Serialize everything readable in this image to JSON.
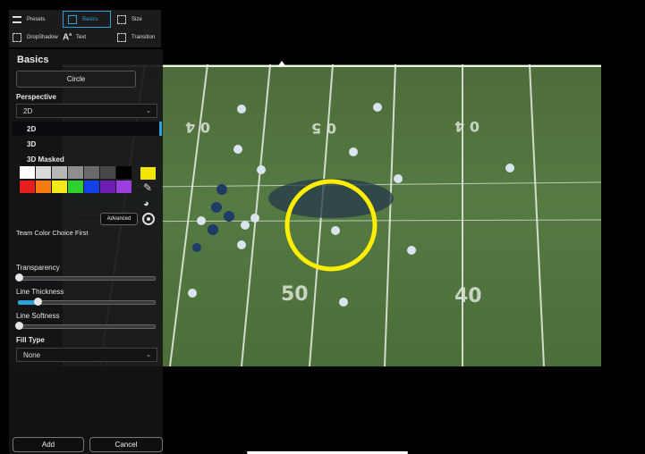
{
  "toolbar": {
    "presets": "Presets",
    "basics": "Basics",
    "size": "Size",
    "dropshadow": "DropShadow",
    "text": "Text",
    "transition": "Transition"
  },
  "panel": {
    "title": "Basics",
    "shape_button": "Circle",
    "perspective_label": "Perspective",
    "perspective_value": "2D",
    "perspective_options": [
      "2D",
      "3D",
      "3D Masked"
    ],
    "advanced_button": "Advanced",
    "team_color_label": "Team Color Choice First",
    "transparency_label": "Transparency",
    "transparency_value": 0.0,
    "line_thickness_label": "Line Thickness",
    "line_thickness_value": 0.14,
    "line_softness_label": "Line Softness",
    "line_softness_value": 0.0,
    "fill_type_label": "Fill Type",
    "fill_type_value": "None",
    "add_button": "Add",
    "cancel_button": "Cancel"
  },
  "colors": {
    "row1": [
      "#ffffff",
      "#d9d9d9",
      "#b7b7b7",
      "#8f8f8f",
      "#6a6a6a",
      "#474747",
      "#000000"
    ],
    "row2": [
      "#e81e1e",
      "#f47c12",
      "#f3e81a",
      "#2fd12f",
      "#1440e8",
      "#6a1fb0",
      "#9b3fe0"
    ],
    "selected": "#f2e600",
    "accent": "#2f9fd8",
    "circle_stroke": "#ffee00"
  },
  "field": {
    "yard_labels": [
      "0 4",
      "0 5",
      "0 4",
      "50",
      "40"
    ]
  }
}
